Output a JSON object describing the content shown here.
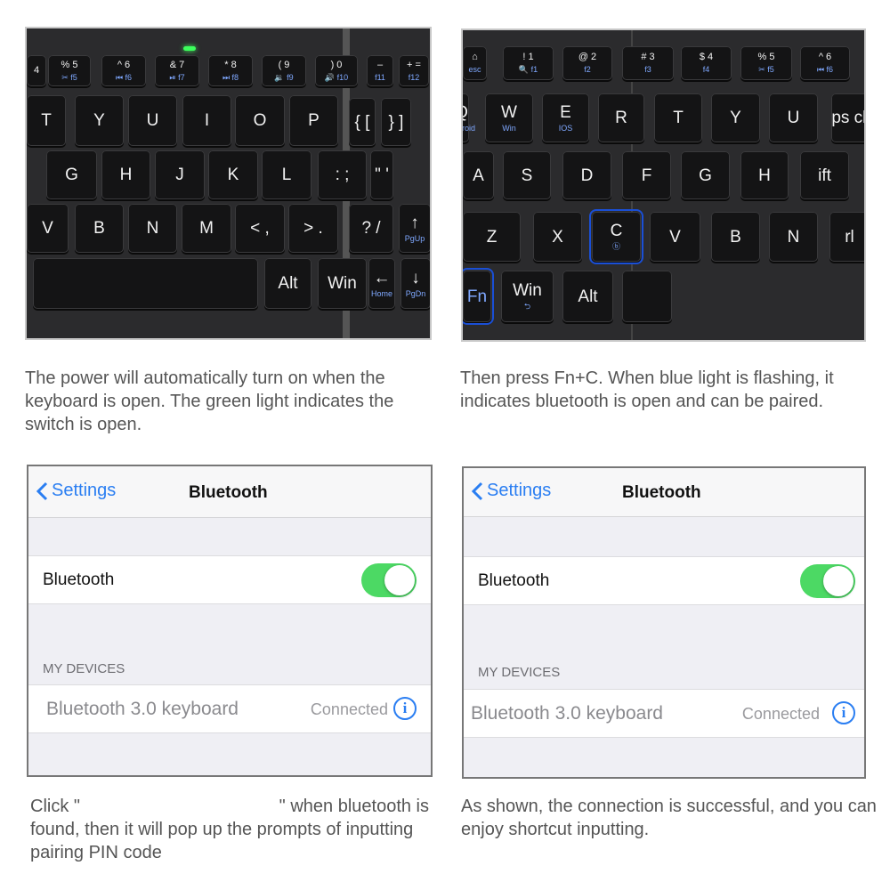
{
  "keyboard_left": {
    "keys": [
      {
        "main": "4",
        "sub": ""
      },
      {
        "main": "% 5",
        "sub": "✂ f5"
      },
      {
        "main": "^ 6",
        "sub": "⏮ f6"
      },
      {
        "main": "& 7",
        "sub": "⏯ f7"
      },
      {
        "main": "* 8",
        "sub": "⏭ f8"
      },
      {
        "main": "( 9",
        "sub": "🔉 f9"
      },
      {
        "main": ") 0",
        "sub": "🔊 f10"
      },
      {
        "main": "–",
        "sub": "f11"
      },
      {
        "main": "+ =",
        "sub": "f12"
      },
      {
        "main": "T",
        "sub": ""
      },
      {
        "main": "Y",
        "sub": ""
      },
      {
        "main": "U",
        "sub": ""
      },
      {
        "main": "I",
        "sub": ""
      },
      {
        "main": "O",
        "sub": ""
      },
      {
        "main": "P",
        "sub": ""
      },
      {
        "main": "{ [",
        "sub": ""
      },
      {
        "main": "} ]",
        "sub": ""
      },
      {
        "main": "G",
        "sub": ""
      },
      {
        "main": "H",
        "sub": ""
      },
      {
        "main": "J",
        "sub": ""
      },
      {
        "main": "K",
        "sub": ""
      },
      {
        "main": "L",
        "sub": ""
      },
      {
        "main": ": ;",
        "sub": ""
      },
      {
        "main": "\" '",
        "sub": ""
      },
      {
        "main": "V",
        "sub": ""
      },
      {
        "main": "B",
        "sub": ""
      },
      {
        "main": "N",
        "sub": ""
      },
      {
        "main": "M",
        "sub": ""
      },
      {
        "main": "< ,",
        "sub": ""
      },
      {
        "main": "> .",
        "sub": ""
      },
      {
        "main": "? /",
        "sub": ""
      },
      {
        "main": "↑",
        "sub": "PgUp"
      },
      {
        "main": "",
        "sub": ""
      },
      {
        "main": "Alt",
        "sub": ""
      },
      {
        "main": "Win",
        "sub": ""
      },
      {
        "main": "←",
        "sub": "Home"
      },
      {
        "main": "↓",
        "sub": "PgDn"
      }
    ],
    "power_light_color": "#3cff5c"
  },
  "keyboard_right": {
    "keys": [
      {
        "main": "⌂",
        "sub": "esc"
      },
      {
        "main": "! 1",
        "sub": "🔍 f1"
      },
      {
        "main": "@ 2",
        "sub": "f2"
      },
      {
        "main": "# 3",
        "sub": "f3"
      },
      {
        "main": "$ 4",
        "sub": "f4"
      },
      {
        "main": "% 5",
        "sub": "✂ f5"
      },
      {
        "main": "^ 6",
        "sub": "⏮ f6"
      },
      {
        "main": "Q",
        "sub": "Android"
      },
      {
        "main": "W",
        "sub": "Win"
      },
      {
        "main": "E",
        "sub": "IOS"
      },
      {
        "main": "R",
        "sub": ""
      },
      {
        "main": "T",
        "sub": ""
      },
      {
        "main": "Y",
        "sub": ""
      },
      {
        "main": "U",
        "sub": ""
      },
      {
        "main": "ps ck",
        "sub": ""
      },
      {
        "main": "A",
        "sub": ""
      },
      {
        "main": "S",
        "sub": ""
      },
      {
        "main": "D",
        "sub": ""
      },
      {
        "main": "F",
        "sub": ""
      },
      {
        "main": "G",
        "sub": ""
      },
      {
        "main": "H",
        "sub": ""
      },
      {
        "main": "ift",
        "sub": ""
      },
      {
        "main": "Z",
        "sub": ""
      },
      {
        "main": "X",
        "sub": ""
      },
      {
        "main": "C",
        "sub": "ⓑ"
      },
      {
        "main": "V",
        "sub": ""
      },
      {
        "main": "B",
        "sub": ""
      },
      {
        "main": "N",
        "sub": ""
      },
      {
        "main": "rl",
        "sub": ""
      },
      {
        "main": "Fn",
        "sub": ""
      },
      {
        "main": "Win",
        "sub": "⮌"
      },
      {
        "main": "Alt",
        "sub": ""
      },
      {
        "main": "",
        "sub": ""
      }
    ],
    "highlight_color": "#1a4fd6"
  },
  "captions": {
    "top_left": "The power will automatically turn on when the keyboard is open. The green light indicates the switch is open.",
    "top_right": "Then press Fn+C. When blue light is flashing, it indicates bluetooth is open and can be paired.",
    "bottom_left_line1_a": "Click \"",
    "bottom_left_line1_b": "\" when bluetooth is",
    "bottom_left_rest": "found, then it will pop up the prompts of inputting pairing PIN code",
    "bottom_right": "As shown,  the connection is successful, and you can enjoy shortcut inputting."
  },
  "ios_left": {
    "back_label": "Settings",
    "title": "Bluetooth",
    "toggle_label": "Bluetooth",
    "toggle_on": true,
    "section_header": "MY DEVICES",
    "device_name": "Bluetooth 3.0 keyboard",
    "device_status": "Connected"
  },
  "ios_right": {
    "back_label": "Settings",
    "title": "Bluetooth",
    "toggle_label": "Bluetooth",
    "toggle_on": true,
    "section_header": "MY DEVICES",
    "device_name": "Bluetooth 3.0 keyboard",
    "device_status": "Connected"
  },
  "colors": {
    "ios_blue": "#2a7ef2",
    "toggle_green": "#4cd964"
  }
}
